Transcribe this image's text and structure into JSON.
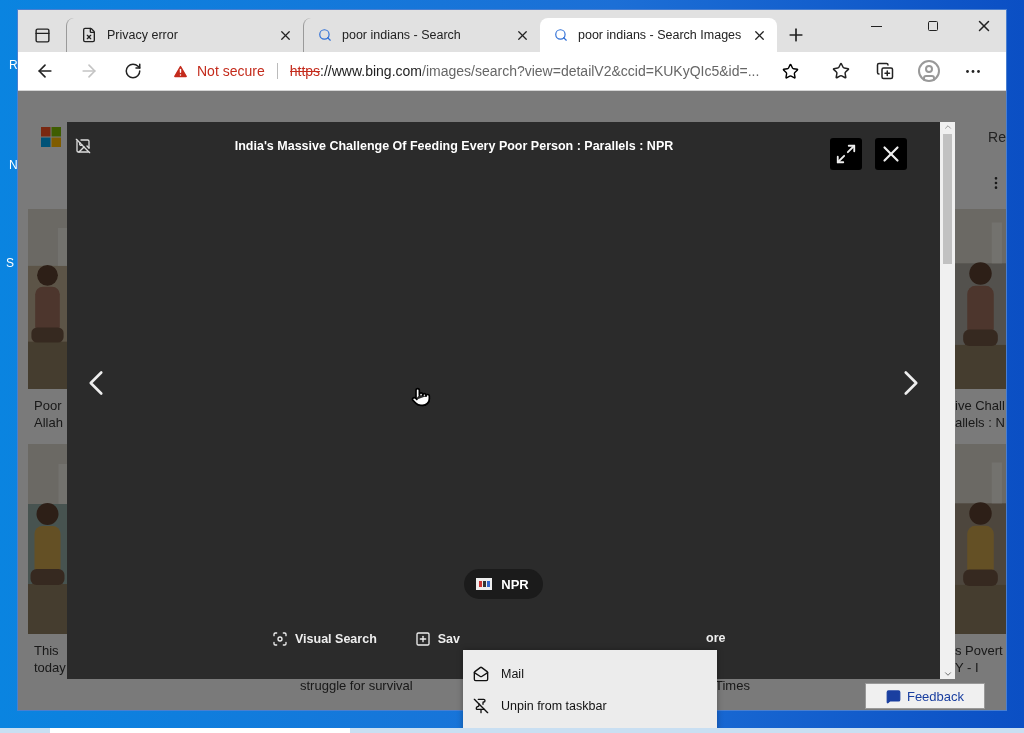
{
  "desktop": {
    "icon_labels": [
      "R",
      "N",
      "S"
    ]
  },
  "browser": {
    "tabs": [
      {
        "title": "Privacy error",
        "kind": "error",
        "selected": false
      },
      {
        "title": "poor indians - Search",
        "kind": "search",
        "selected": false
      },
      {
        "title": "poor indians - Search Images",
        "kind": "search",
        "selected": true
      }
    ],
    "forward": {
      "disabled": true
    },
    "address_bar": {
      "security": "Not secure",
      "url_scheme": "https",
      "url_host": "://www.bing.com",
      "url_path": "/images/search?view=detailV2&ccid=KUKyQIc5&id=..."
    }
  },
  "page": {
    "header_link": "Re",
    "left_results": [
      {
        "caption_lines": [
          "Poor",
          "Allah"
        ]
      },
      {
        "caption_lines": [
          "This",
          "today"
        ]
      }
    ],
    "right_results": [
      {
        "caption_lines": [
          "ive Chall",
          "allels : N"
        ]
      },
      {
        "caption_lines": [
          "s Povert",
          "Y - I"
        ]
      }
    ],
    "bottom_captions": [
      "struggle for survival",
      "Times"
    ],
    "feedback": "Feedback"
  },
  "viewer": {
    "title": "India's Massive Challenge Of Feeding Every Poor Person : Parallels : NPR",
    "source": "NPR",
    "actions": [
      {
        "label": "Visual Search",
        "kind": "visual-search"
      },
      {
        "label": "Sav",
        "kind": "save"
      },
      {
        "label": "ore",
        "kind": "more"
      }
    ]
  },
  "context_menu": {
    "items": [
      {
        "label": "Mail",
        "kind": "mail"
      },
      {
        "label": "Unpin from taskbar",
        "kind": "unpin"
      }
    ]
  }
}
